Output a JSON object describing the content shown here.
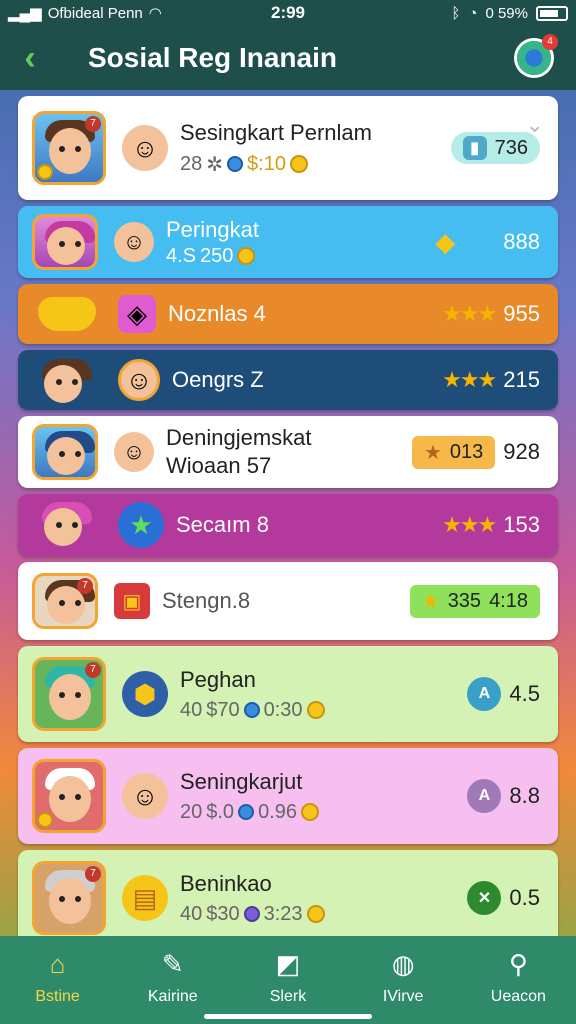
{
  "status": {
    "carrier": "Ofbideal Penn",
    "time": "2:99",
    "battery": "0 59%"
  },
  "header": {
    "title": "Sosial Reg Inanain",
    "notif": "4"
  },
  "rows": [
    {
      "name": "Sesingkart Pernlam",
      "sub1": "28",
      "sub2": "$:10",
      "score": "736"
    },
    {
      "name": "Peringkat",
      "sub1": "4.S",
      "sub2": "250",
      "score": "888"
    },
    {
      "name": "Noznlas 4",
      "score": "955"
    },
    {
      "name": "Oengrs Z",
      "score": "215"
    },
    {
      "name": "Deningjemskat",
      "name2": "Wioaan 57",
      "badge": "013",
      "score": "928"
    },
    {
      "name": "Secaım 8",
      "score": "153"
    },
    {
      "name": "Stengn.8",
      "badge": "335",
      "score": "4:18"
    },
    {
      "name": "Peghan",
      "sub1": "40",
      "sub2": "$70",
      "sub3": "0:30",
      "score": "4.5"
    },
    {
      "name": "Seningkarjut",
      "sub1": "20",
      "sub2": "$.0",
      "sub3": "0.96",
      "score": "8.8"
    },
    {
      "name": "Beninkao",
      "sub1": "40",
      "sub2": "$30",
      "sub3": "3:23",
      "score": "0.5"
    }
  ],
  "tabs": [
    {
      "label": "Bstine"
    },
    {
      "label": "Kairine"
    },
    {
      "label": "Slerk"
    },
    {
      "label": "IVirve"
    },
    {
      "label": "Ueacon"
    }
  ]
}
